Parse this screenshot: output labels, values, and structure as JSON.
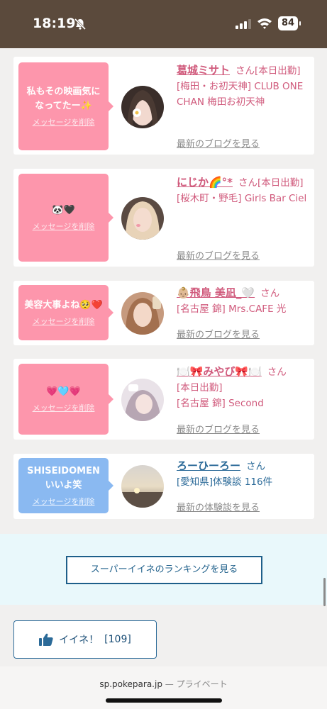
{
  "status_bar": {
    "time": "18:19",
    "battery": "84"
  },
  "cards": [
    {
      "message": "私もその映画気になってたー✨",
      "delete_label": "メッセージを削除",
      "name": "葛城ミサト",
      "honorific": "さん",
      "detail_lines": [
        "[本日出勤]",
        "[梅田・お初天神] CLUB ONE CHAN 梅田お初天神"
      ],
      "link": "最新のブログを見る"
    },
    {
      "message": "🐼🖤",
      "delete_label": "メッセージを削除",
      "name": "にじか🌈°*",
      "honorific": "さん",
      "detail_lines": [
        "[本日出勤]",
        "[桜木町・野毛] Girls Bar Ciel"
      ],
      "link": "最新のブログを見る"
    },
    {
      "message": "美容大事よね🥺❤️",
      "delete_label": "メッセージを削除",
      "name": "👶🏼飛鳥 美凪_🤍",
      "honorific": "さん",
      "detail_lines": [
        "[名古屋 錦] Mrs.CAFE 光"
      ],
      "link": "最新のブログを見る"
    },
    {
      "message": "💗🩵💗",
      "delete_label": "メッセージを削除",
      "name": "🍽️🎀みやび🎀🍽️",
      "honorific": "さん",
      "detail_lines": [
        "[本日出勤]",
        "[名古屋 錦] Second"
      ],
      "link": "最新のブログを見る"
    },
    {
      "message": "SHISEIDOMENいいよ笑",
      "delete_label": "メッセージを削除",
      "name": "ろーひーろー",
      "honorific": "さん",
      "detail_lines": [
        "[愛知県]体験談 116件"
      ],
      "link": "最新の体験談を見る"
    }
  ],
  "ranking_button": "スーパーイイネのランキングを見る",
  "like_button": {
    "label": "イイネ！",
    "count": "[109]"
  },
  "url_bar": {
    "domain": "sp.pokepara.jp",
    "separator": "—",
    "private_label": "プライベート"
  },
  "colors": {
    "status_bar": "#5b4a3c",
    "pink_bubble": "#fd96ac",
    "blue_bubble": "#8ab9f1",
    "cast_text": "#d05a7c",
    "user_text": "#2b6a98"
  }
}
